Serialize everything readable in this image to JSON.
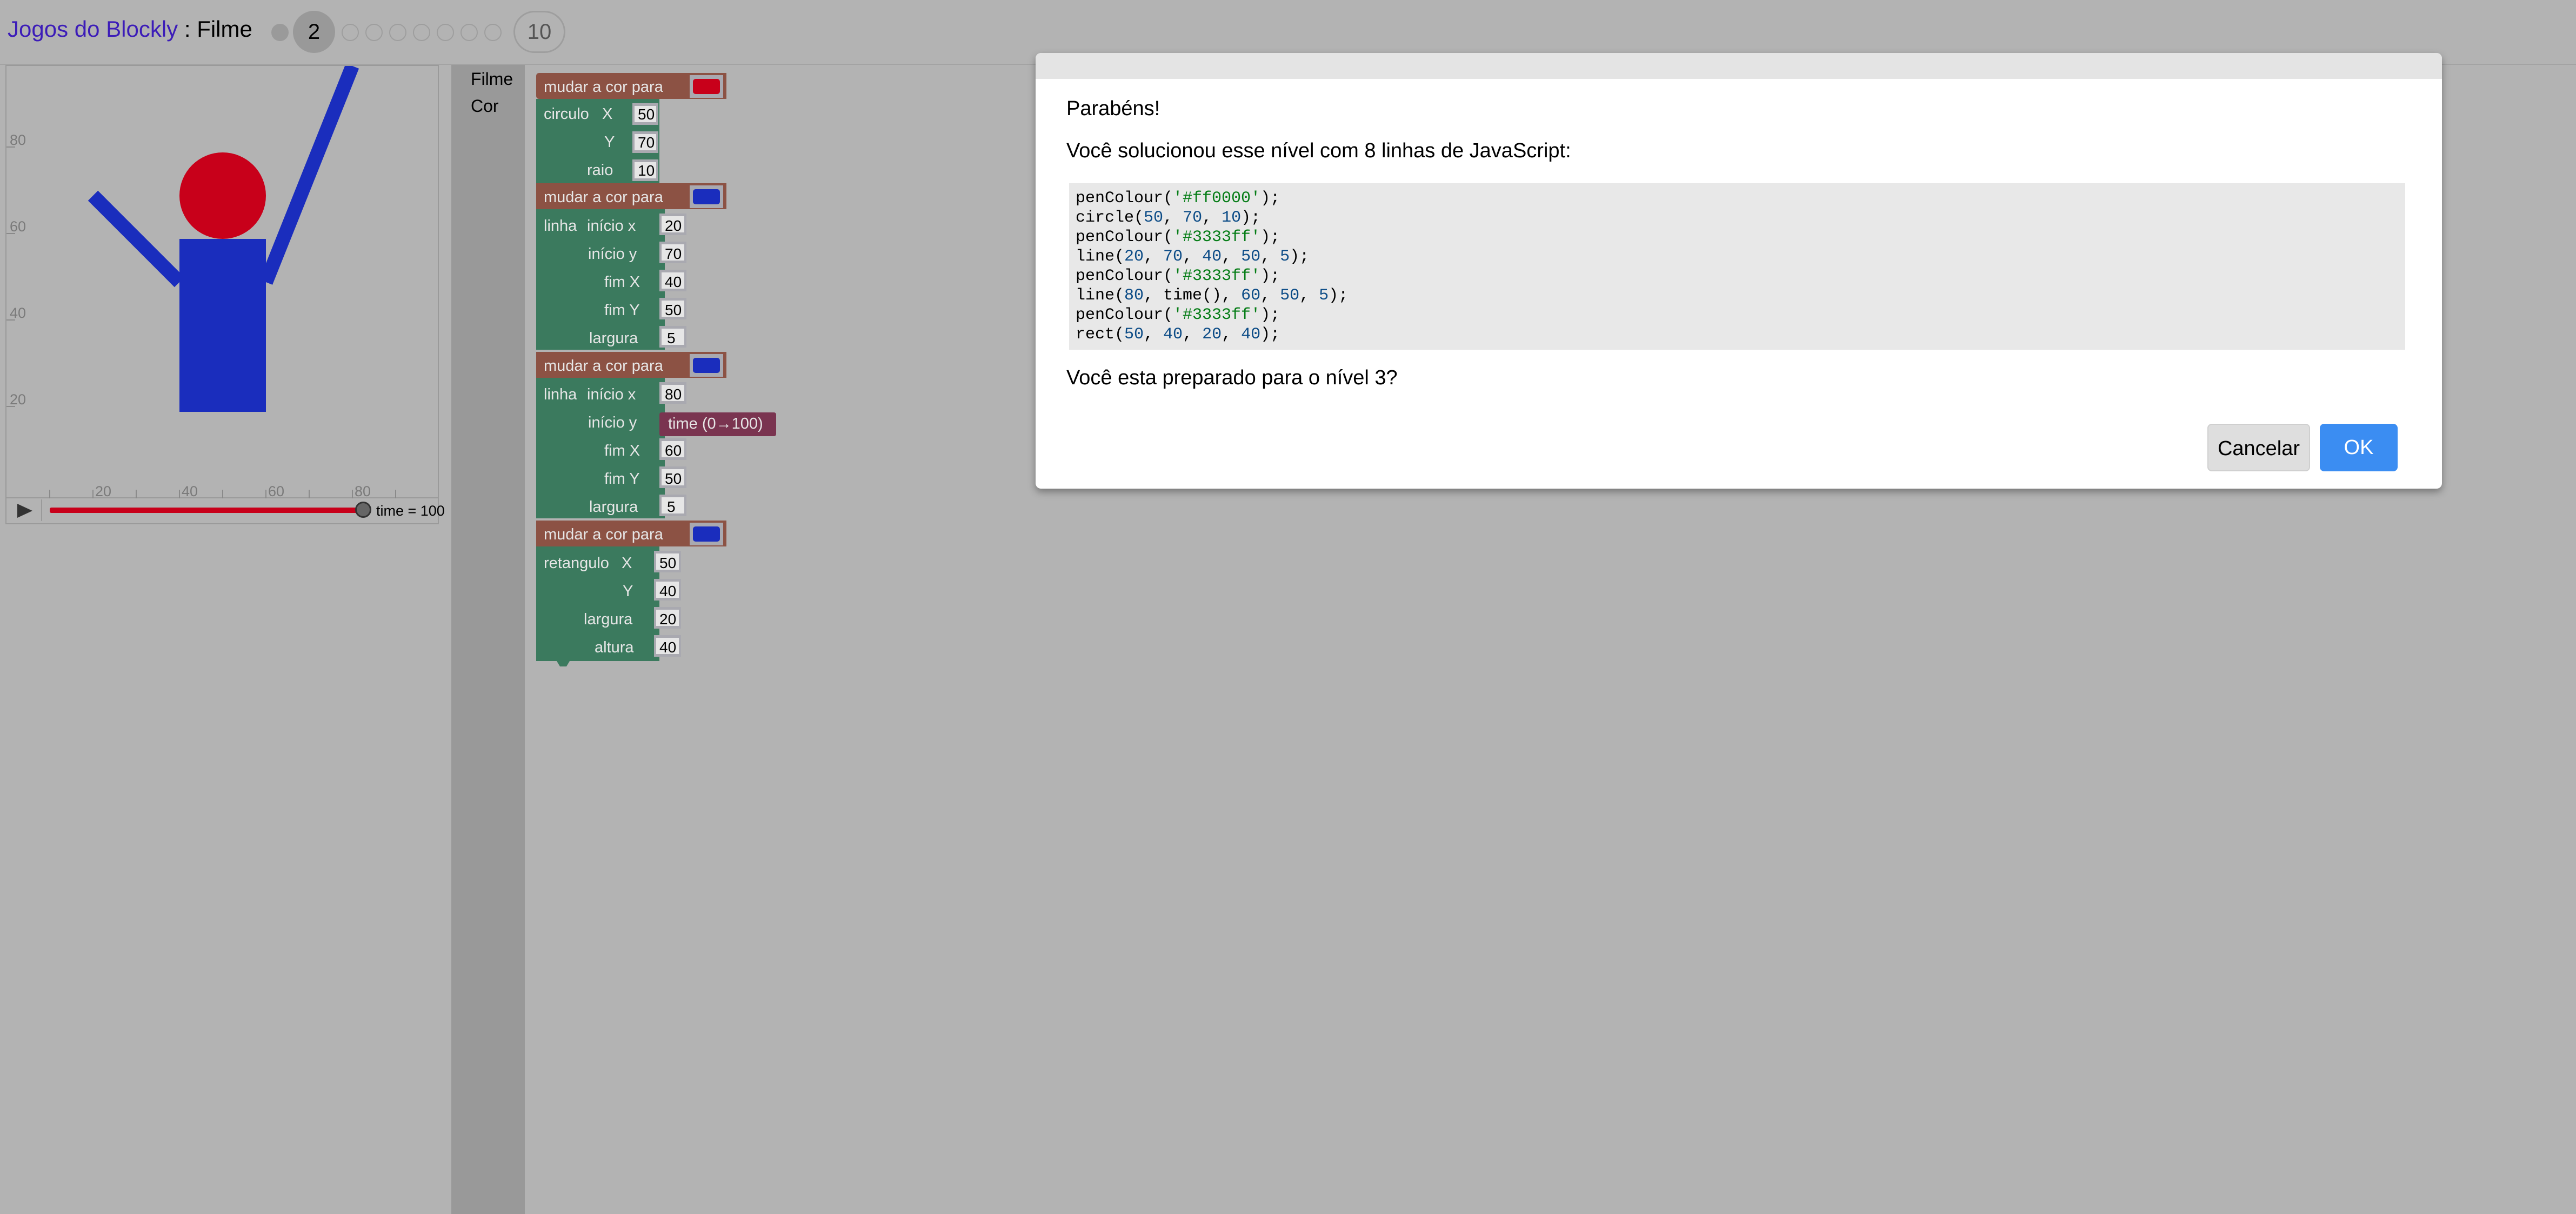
{
  "header": {
    "app_link": "Jogos do Blockly",
    "separator": " : ",
    "game_name": "Filme",
    "current_level": "2",
    "last_level": "10"
  },
  "visual": {
    "y_ticks": [
      "80",
      "60",
      "40",
      "20"
    ],
    "x_ticks": [
      "20",
      "40",
      "60",
      "80"
    ],
    "time_label": "time = 100",
    "time_progress": 1.0,
    "colors": {
      "red": "#c8001a",
      "blue": "#1a2dbd"
    }
  },
  "toolbox": {
    "items": [
      "Filme",
      "Cor"
    ]
  },
  "blocks": {
    "set_colour_label": "mudar a cor para",
    "circle": {
      "label": "circulo",
      "x_label": "X",
      "y_label": "Y",
      "r_label": "raio",
      "x": "50",
      "y": "70",
      "r": "10"
    },
    "line1": {
      "label": "linha",
      "start_x_label": "início x",
      "start_y_label": "início y",
      "end_x_label": "fim X",
      "end_y_label": "fim Y",
      "width_label": "largura",
      "start_x": "20",
      "start_y": "70",
      "end_x": "40",
      "end_y": "50",
      "width": "5"
    },
    "line2": {
      "label": "linha",
      "start_x_label": "início x",
      "start_y_label": "início y",
      "end_x_label": "fim X",
      "end_y_label": "fim Y",
      "width_label": "largura",
      "start_x": "80",
      "start_y_block": "time (0→100)",
      "end_x": "60",
      "end_y": "50",
      "width": "5"
    },
    "rect": {
      "label": "retangulo",
      "x_label": "X",
      "y_label": "Y",
      "w_label": "largura",
      "h_label": "altura",
      "x": "50",
      "y": "40",
      "w": "20",
      "h": "40"
    },
    "swatch_colors": [
      "#c8001a",
      "#1a2dbd",
      "#1a2dbd",
      "#1a2dbd"
    ]
  },
  "dialog": {
    "congrats": "Parabéns!",
    "solved": "Você solucionou esse nível com 8 linhas de JavaScript:",
    "code_lines": [
      "penColour('#ff0000');",
      "circle(50, 70, 10);",
      "penColour('#3333ff');",
      "line(20, 70, 40, 50, 5);",
      "penColour('#3333ff');",
      "line(80, time(), 60, 50, 5);",
      "penColour('#3333ff');",
      "rect(50, 40, 20, 40);"
    ],
    "question": "Você esta preparado para o nível 3?",
    "cancel_label": "Cancelar",
    "ok_label": "OK"
  }
}
